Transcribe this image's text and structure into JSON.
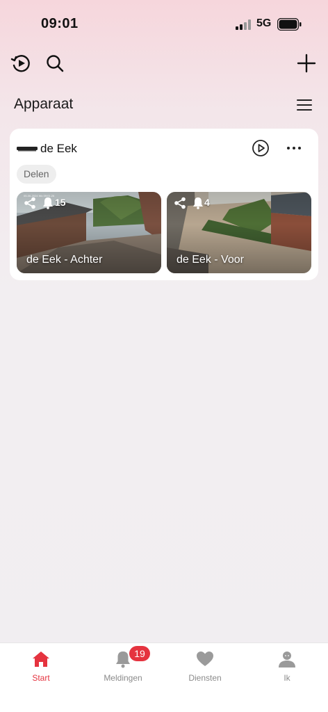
{
  "status_bar": {
    "time": "09:01",
    "network": "5G"
  },
  "toolbar": {
    "playback_icon": "playback-history-icon",
    "search_icon": "search-icon",
    "add_icon": "plus-icon"
  },
  "page": {
    "title": "Apparaat",
    "menu_icon": "hamburger-menu-icon"
  },
  "device": {
    "name": "de Eek",
    "share_label": "Delen",
    "cameras": [
      {
        "label": "de Eek - Achter",
        "alerts": "15",
        "osd": "05-06-2024 Wo 09:01:26"
      },
      {
        "label": "de Eek - Voor",
        "alerts": "4",
        "osd": ""
      }
    ]
  },
  "tabs": [
    {
      "label": "Start",
      "icon": "home-icon",
      "active": true
    },
    {
      "label": "Meldingen",
      "icon": "bell-icon",
      "badge": "19"
    },
    {
      "label": "Diensten",
      "icon": "heart-icon"
    },
    {
      "label": "Ik",
      "icon": "person-icon"
    }
  ],
  "colors": {
    "accent": "#e5333f",
    "card": "#ffffff"
  }
}
